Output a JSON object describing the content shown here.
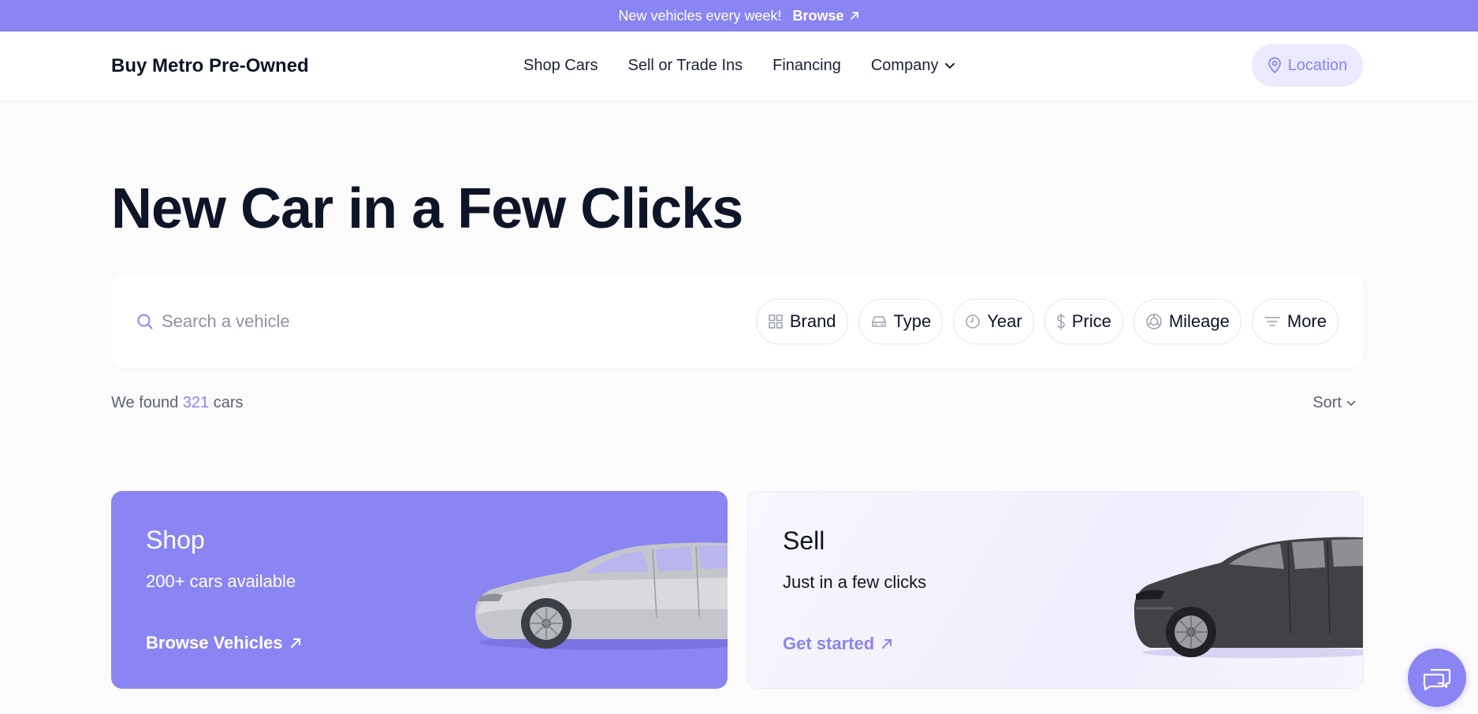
{
  "announcement": {
    "text": "New vehicles every week!",
    "link_label": "Browse"
  },
  "header": {
    "brand": "Buy Metro Pre-Owned",
    "nav": [
      "Shop Cars",
      "Sell or Trade Ins",
      "Financing",
      "Company"
    ],
    "location_label": "Location"
  },
  "hero": {
    "title": "New Car in a Few Clicks"
  },
  "search": {
    "placeholder": "Search a vehicle",
    "filters": [
      "Brand",
      "Type",
      "Year",
      "Price",
      "Mileage",
      "More"
    ]
  },
  "results": {
    "prefix": "We found",
    "count": "321",
    "suffix": "cars",
    "sort_label": "Sort"
  },
  "cards": {
    "shop": {
      "title": "Shop",
      "subtitle": "200+ cars available",
      "link": "Browse Vehicles"
    },
    "sell": {
      "title": "Sell",
      "subtitle": "Just in a few clicks",
      "link": "Get started"
    }
  },
  "colors": {
    "accent": "#8b84f3",
    "accent_light": "#ebe9fd",
    "text_dark": "#0f1528",
    "background": "#fbfbfc"
  }
}
